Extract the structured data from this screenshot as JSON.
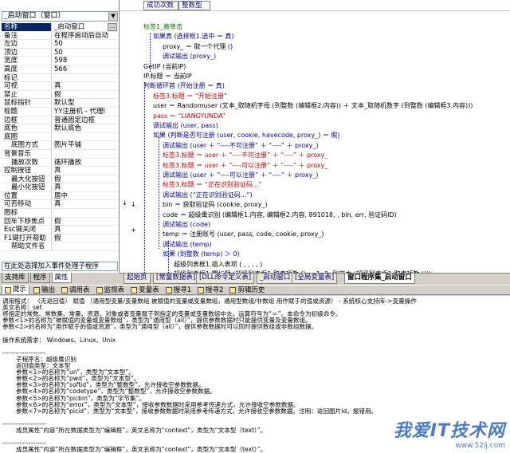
{
  "left_panel": {
    "object_selector": "_启动窗口（窗口）",
    "properties": [
      {
        "name": "名称",
        "value": "_启动窗口",
        "selected": true
      },
      {
        "name": "备注",
        "value": "在程序启动后自动"
      },
      {
        "name": "左边",
        "value": "50"
      },
      {
        "name": "顶边",
        "value": "50"
      },
      {
        "name": "宽度",
        "value": "598"
      },
      {
        "name": "高度",
        "value": "566"
      },
      {
        "name": "标记",
        "value": ""
      },
      {
        "name": "可视",
        "value": "真"
      },
      {
        "name": "禁止",
        "value": "假"
      },
      {
        "name": "鼠标指针",
        "value": "默认型"
      },
      {
        "name": "标题",
        "value": "YY注册机 - 代理I"
      },
      {
        "name": "边框",
        "value": "普通固定边框"
      },
      {
        "name": "底色",
        "value": "默认底色"
      },
      {
        "name": "底图",
        "value": ""
      },
      {
        "name": "底图方式",
        "value": "图片平铺",
        "sub": true
      },
      {
        "name": "背景音乐",
        "value": ""
      },
      {
        "name": "播放次数",
        "value": "循环播放",
        "sub": true
      },
      {
        "name": "控制按钮",
        "value": "真"
      },
      {
        "name": "最大化按钮",
        "value": "假",
        "sub": true
      },
      {
        "name": "最小化按钮",
        "value": "真",
        "sub": true
      },
      {
        "name": "位置",
        "value": "居中"
      },
      {
        "name": "可否移动",
        "value": "真"
      },
      {
        "name": "图标",
        "value": ""
      },
      {
        "name": "回车下移焦点",
        "value": "假"
      },
      {
        "name": "Esc键关闭",
        "value": "真"
      },
      {
        "name": "F1键打开帮助",
        "value": "假"
      },
      {
        "name": "帮助文件名",
        "value": "",
        "sub": true
      }
    ],
    "event_selector": "在此处选择加入事件处理子程序",
    "tabs": [
      "支持库",
      "程序",
      "属性"
    ]
  },
  "top_strip": {
    "left_cell": "成功次数",
    "right_cell": "整数型"
  },
  "gutter_markers": [
    "↓",
    "↓",
    "+"
  ],
  "code_lines": [
    {
      "t": "标签1_被单击",
      "c": "g",
      "indent": 0
    },
    {
      "t": "如果真 (选择框1.选中 ＝ 真)",
      "c": "k",
      "indent": 1
    },
    {
      "t": "proxy_ ＝ 取一个代理 ()",
      "c": "n",
      "indent": 2
    },
    {
      "t": "调试输出 (proxy_)",
      "c": "k",
      "indent": 2
    },
    {
      "t": "GetIP (当前IP)",
      "c": "n",
      "indent": 0
    },
    {
      "t": "IP.标题 ＝ 当前IP",
      "c": "n",
      "indent": 0
    },
    {
      "t": "判断循环首 (开始注册 ＝ 真)",
      "c": "k",
      "indent": 0
    },
    {
      "t": "标签3.标题 ＝ “开始注册”",
      "c": "s",
      "indent": 1
    },
    {
      "t": "user ＝ Randomuser (文本_取随机字母 (到整数 (编辑框2.内容)) ＋ 文本_取随机数字 (到整数 (编辑框3.内容)))",
      "c": "n",
      "indent": 1
    },
    {
      "t": "pass ＝ “LIANGYUNDA”",
      "c": "s",
      "indent": 1
    },
    {
      "t": "调试输出 (user, pass)",
      "c": "k",
      "indent": 1
    },
    {
      "t": "如果 (判断是否可注册 (user, cookie, havecode, proxy_) ＝ 假)",
      "c": "k",
      "indent": 1
    },
    {
      "t": "调试输出 (user ＋ “----不可注册” ＋ “----” ＋ proxy_)",
      "c": "k",
      "indent": 2
    },
    {
      "t": "标签3.标题 ＝ user ＋ “----不可注册” ＋ “----” ＋ proxy_",
      "c": "s",
      "indent": 2
    },
    {
      "t": "标签3.标题 ＝ user ＋ “----可以注册” ＋ “----” ＋ proxy_",
      "c": "s",
      "indent": 2
    },
    {
      "t": "调试输出 (user ＋ “----可以注册” ＋ “----” ＋ proxy_)",
      "c": "k",
      "indent": 2
    },
    {
      "t": "标签3.标题 ＝ “正在识别验证码...”",
      "c": "s",
      "indent": 2
    },
    {
      "t": "调试输出 (“正在识别验证码...”)",
      "c": "k",
      "indent": 2
    },
    {
      "t": "bin ＝ 获取验证码 (cookie, proxy_)",
      "c": "n",
      "indent": 2
    },
    {
      "t": "code ＝ 超级鹰识别 (编辑框1.内容, 编辑框2.内容, 891018, , bin, err, 验证码ID)",
      "c": "n",
      "indent": 2
    },
    {
      "t": "调试输出 (code)",
      "c": "k",
      "indent": 2
    },
    {
      "t": "temp ＝ 注册账号 (user, pass, code, cookie, proxy_)",
      "c": "n",
      "indent": 2
    },
    {
      "t": "调试输出 (temp)",
      "c": "k",
      "indent": 2
    },
    {
      "t": "如果 (到整数 (temp) ＞ 0)",
      "c": "k",
      "indent": 2
    },
    {
      "t": "超级列表框1.插入表项 ( , , , , )",
      "c": "n",
      "indent": 3
    },
    {
      "t": "超级列表框1.置标题 (超级列表框1.取表项数 () － 1, 0, 到文本 (超级列表框1.取表项数 ()))",
      "c": "n",
      "indent": 3
    }
  ],
  "module_tabs": [
    "起始页",
    "[常量数据表]",
    "[DLL命令定义表]",
    "_启动窗口",
    "[全局变量表]",
    "窗口程序集_启动窗口"
  ],
  "bottom_tabs": [
    "提示",
    "输出",
    "调用表",
    "监视表",
    "变量表",
    "搜寻1",
    "搜寻2",
    "剪辑历史"
  ],
  "output_lines": [
    {
      "t": "调用格式： 〈无返回值〉 赋值 （通用型变量/变量数组 被赋值的变量或变量数组，通用型数组/非数组 用作赋于的值或资源） - 系统核心支持库->变量操作",
      "i": 0
    },
    {
      "t": "英文名称：set",
      "i": 0
    },
    {
      "t": "将指定的常数、常数集、常量、资源、对象或者变量赋于到指定的变量或变量数组中去。运算符号为“＝”。本命令为初级命令。",
      "i": 0
    },
    {
      "t": "参数<1>的名称为“被赋值的变量或变量数组”，类型为“通用型（all）”，提供参数数据时只能提供变量及变量数组。",
      "i": 0
    },
    {
      "t": "参数<2>的名称为“用作赋于的值或资源”，类型为“通用型（all）”，提供参数数据时可以同时提供数组或非数组数据。",
      "i": 0
    },
    {
      "t": "",
      "i": 0
    },
    {
      "t": "操作系统需求： Windows、Linux、Unix",
      "i": 0
    },
    {
      "t": "",
      "i": 0
    },
    {
      "t": "--------------------",
      "i": 0
    },
    {
      "t": "子程序名：超级鹰识别",
      "i": 1
    },
    {
      "t": "返回值类型：文本型",
      "i": 1
    },
    {
      "t": "参数<1>的名称为“un”，类型为“文本型”。",
      "i": 1
    },
    {
      "t": "参数<2>的名称为“pwd”，类型为“文本型”。",
      "i": 1
    },
    {
      "t": "参数<3>的名称为“softid”，类型为“整数型”，允许接收空参数数据。",
      "i": 1
    },
    {
      "t": "参数<4>的名称为“codetype”，类型为“整数型”，允许接收空参数数据。",
      "i": 1
    },
    {
      "t": "参数<5>的名称为“picbin”，类型为“字节集”。",
      "i": 1
    },
    {
      "t": "参数<6>的名称为“error”，类型为“文本型”，接收参数数据时采用参考传递方式，允许接收空参数数据。",
      "i": 1
    },
    {
      "t": "参数<7>的名称为“picid”，类型为“文本型”，接收参数数据时采用参考传递方式，允许接收空参数数据。注明：返回图片id，报错用。",
      "i": 1
    },
    {
      "t": "",
      "i": 0
    },
    {
      "t": "--------------------",
      "i": 0
    },
    {
      "t": "成员属性“内容”所在数据类型为“编辑框”，英文名称为“context”，类型为“文本型（text）”。",
      "i": 1
    },
    {
      "t": "",
      "i": 0
    },
    {
      "t": "--------------------",
      "i": 0
    },
    {
      "t": "成员属性“内容”所在数据类型为“编辑框”，英文名称为“context”，类型为“文本型（text）”。",
      "i": 1
    }
  ],
  "watermark": {
    "line1": "我爱IT技术网",
    "line2": "www.52ij.com"
  }
}
